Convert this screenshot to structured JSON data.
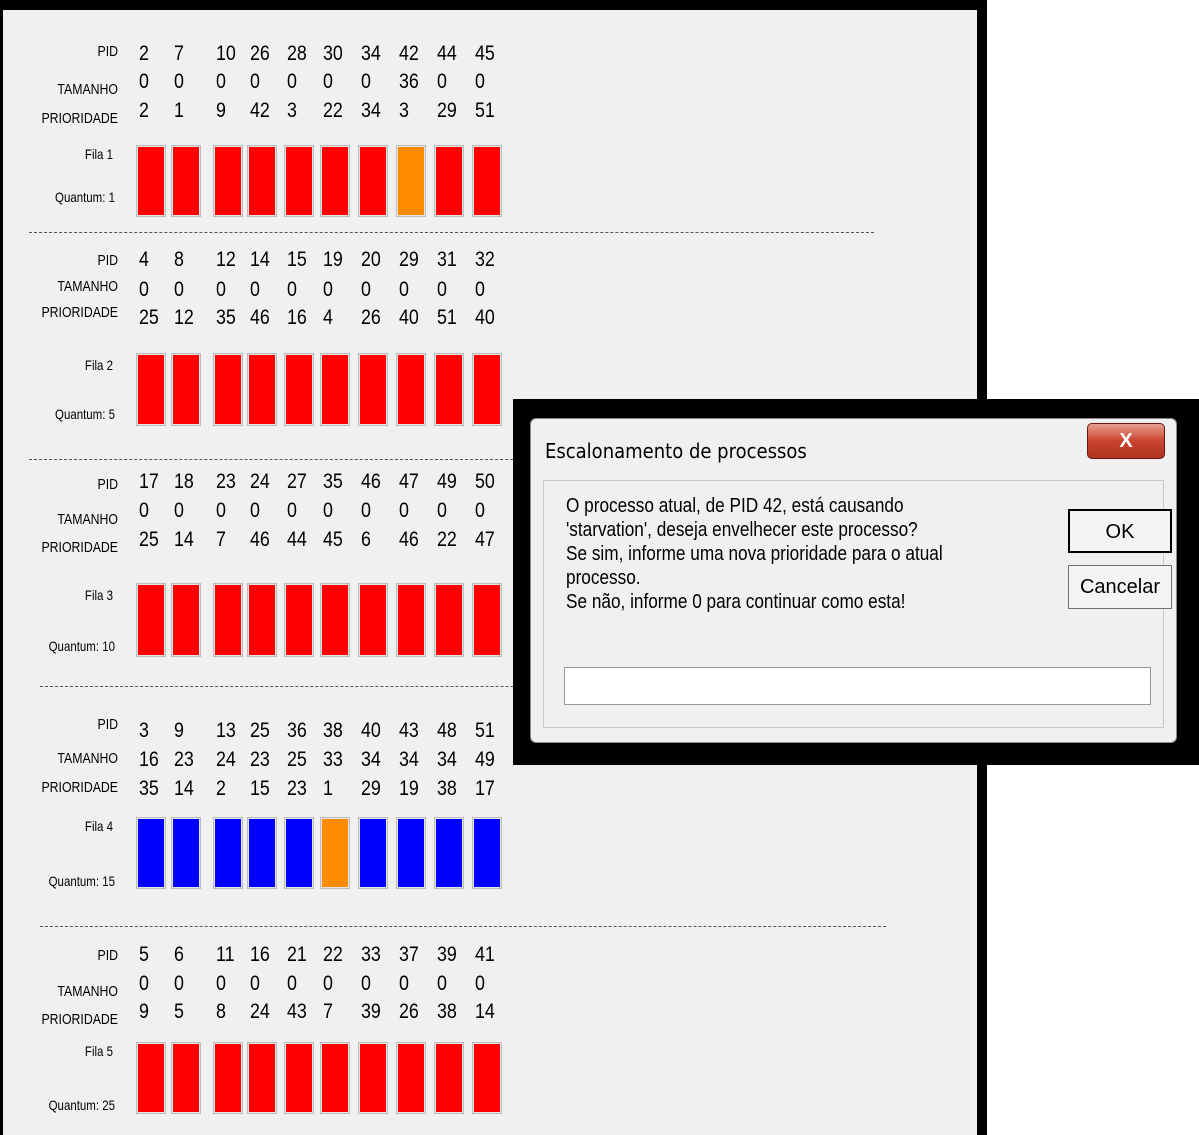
{
  "queues": [
    {
      "row_labels": {
        "pid": "PID",
        "size": "TAMANHO",
        "priority": "PRIORIDADE"
      },
      "queue_label": "Fila 1",
      "quantum_label": "Quantum: 1",
      "pid": [
        "2",
        "7",
        "10",
        "26",
        "28",
        "30",
        "34",
        "42",
        "44",
        "45"
      ],
      "size": [
        "0",
        "0",
        "0",
        "0",
        "0",
        "0",
        "0",
        "36",
        "0",
        "0"
      ],
      "priority": [
        "2",
        "1",
        "9",
        "42",
        "3",
        "22",
        "34",
        "3",
        "29",
        "51"
      ],
      "bar_colors": [
        "#ff0000",
        "#ff0000",
        "#ff0000",
        "#ff0000",
        "#ff0000",
        "#ff0000",
        "#ff0000",
        "#ff8c00",
        "#ff0000",
        "#ff0000"
      ]
    },
    {
      "row_labels": {
        "pid": "PID",
        "size": "TAMANHO",
        "priority": "PRIORIDADE"
      },
      "queue_label": "Fila 2",
      "quantum_label": "Quantum: 5",
      "pid": [
        "4",
        "8",
        "12",
        "14",
        "15",
        "19",
        "20",
        "29",
        "31",
        "32"
      ],
      "size": [
        "0",
        "0",
        "0",
        "0",
        "0",
        "0",
        "0",
        "0",
        "0",
        "0"
      ],
      "priority": [
        "25",
        "12",
        "35",
        "46",
        "16",
        "4",
        "26",
        "40",
        "51",
        "40"
      ],
      "bar_colors": [
        "#ff0000",
        "#ff0000",
        "#ff0000",
        "#ff0000",
        "#ff0000",
        "#ff0000",
        "#ff0000",
        "#ff0000",
        "#ff0000",
        "#ff0000"
      ]
    },
    {
      "row_labels": {
        "pid": "PID",
        "size": "TAMANHO",
        "priority": "PRIORIDADE"
      },
      "queue_label": "Fila 3",
      "quantum_label": "Quantum: 10",
      "pid": [
        "17",
        "18",
        "23",
        "24",
        "27",
        "35",
        "46",
        "47",
        "49",
        "50"
      ],
      "size": [
        "0",
        "0",
        "0",
        "0",
        "0",
        "0",
        "0",
        "0",
        "0",
        "0"
      ],
      "priority": [
        "25",
        "14",
        "7",
        "46",
        "44",
        "45",
        "6",
        "46",
        "22",
        "47"
      ],
      "bar_colors": [
        "#ff0000",
        "#ff0000",
        "#ff0000",
        "#ff0000",
        "#ff0000",
        "#ff0000",
        "#ff0000",
        "#ff0000",
        "#ff0000",
        "#ff0000"
      ]
    },
    {
      "row_labels": {
        "pid": "PID",
        "size": "TAMANHO",
        "priority": "PRIORIDADE"
      },
      "queue_label": "Fila 4",
      "quantum_label": "Quantum: 15",
      "pid": [
        "3",
        "9",
        "13",
        "25",
        "36",
        "38",
        "40",
        "43",
        "48",
        "51"
      ],
      "size": [
        "16",
        "23",
        "24",
        "23",
        "25",
        "33",
        "34",
        "34",
        "34",
        "49"
      ],
      "priority": [
        "35",
        "14",
        "2",
        "15",
        "23",
        "1",
        "29",
        "19",
        "38",
        "17"
      ],
      "bar_colors": [
        "#0000ff",
        "#0000ff",
        "#0000ff",
        "#0000ff",
        "#0000ff",
        "#ff8c00",
        "#0000ff",
        "#0000ff",
        "#0000ff",
        "#0000ff"
      ]
    },
    {
      "row_labels": {
        "pid": "PID",
        "size": "TAMANHO",
        "priority": "PRIORIDADE"
      },
      "queue_label": "Fila 5",
      "quantum_label": "Quantum: 25",
      "pid": [
        "5",
        "6",
        "11",
        "16",
        "21",
        "22",
        "33",
        "37",
        "39",
        "41"
      ],
      "size": [
        "0",
        "0",
        "0",
        "0",
        "0",
        "0",
        "0",
        "0",
        "0",
        "0"
      ],
      "priority": [
        "9",
        "5",
        "8",
        "24",
        "43",
        "7",
        "39",
        "26",
        "38",
        "14"
      ],
      "bar_colors": [
        "#ff0000",
        "#ff0000",
        "#ff0000",
        "#ff0000",
        "#ff0000",
        "#ff0000",
        "#ff0000",
        "#ff0000",
        "#ff0000",
        "#ff0000"
      ]
    }
  ],
  "dialog": {
    "title": "Escalonamento de processos",
    "close_label": "X",
    "message_lines": [
      "O processo atual, de PID 42, está causando",
      "'starvation', deseja envelhecer este processo?",
      "Se sim, informe uma nova prioridade para o atual",
      "processo.",
      "Se não, informe 0 para continuar como esta!"
    ],
    "ok_label": "OK",
    "cancel_label": "Cancelar",
    "input_value": ""
  }
}
